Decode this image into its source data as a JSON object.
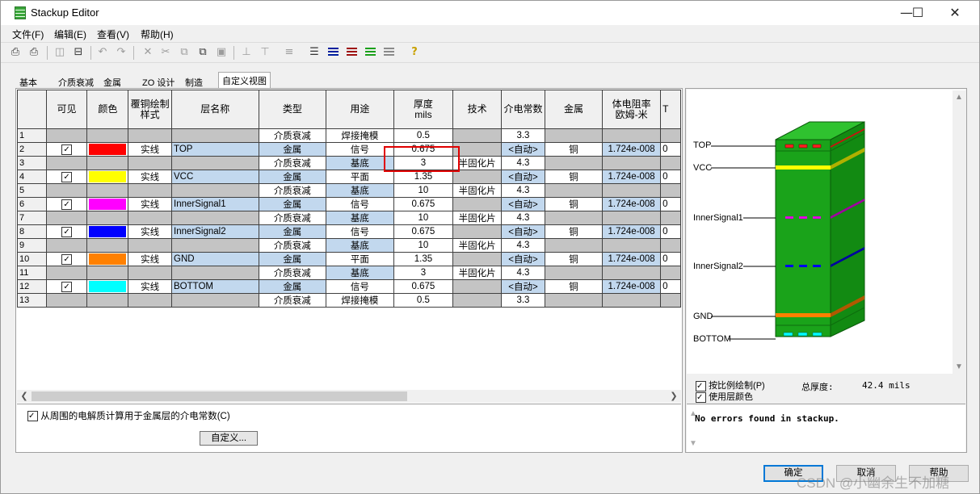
{
  "window": {
    "title": "Stackup Editor",
    "minimize": "—",
    "maximize": "☐",
    "close": "✕"
  },
  "menu": [
    "文件(F)",
    "编辑(E)",
    "查看(V)",
    "帮助(H)"
  ],
  "tabs": [
    "基本",
    "介质衰减",
    "金属",
    "ZO 设计",
    "制造",
    "自定义视图"
  ],
  "active_tab": "自定义视图",
  "grid": {
    "headers": [
      "可见",
      "颜色",
      "覆铜绘制\n样式",
      "层名称",
      "类型",
      "用途",
      "厚度\nmils",
      "技术",
      "介电常数",
      "金属",
      "体电阻率\n欧姆-米",
      "T"
    ],
    "rows": [
      {
        "num": "1",
        "visible": false,
        "color": "",
        "style": "",
        "name": "",
        "type": "介质衰减",
        "usage": "焊接掩模",
        "thickness": "0.5",
        "tech": "",
        "dk": "3.3",
        "metal": "",
        "resist": "",
        "extra": ""
      },
      {
        "num": "2",
        "visible": true,
        "color": "#ff0000",
        "style": "实线",
        "name": "TOP",
        "type": "金属",
        "usage": "信号",
        "thickness": "0.675",
        "tech": "",
        "dk": "<自动>",
        "metal": "铜",
        "resist": "1.724e-008",
        "extra": "0"
      },
      {
        "num": "3",
        "visible": false,
        "color": "",
        "style": "",
        "name": "",
        "type": "介质衰减",
        "usage": "基底",
        "thickness": "3",
        "tech": "半固化片",
        "dk": "4.3",
        "metal": "",
        "resist": "",
        "extra": ""
      },
      {
        "num": "4",
        "visible": true,
        "color": "#ffff00",
        "style": "实线",
        "name": "VCC",
        "type": "金属",
        "usage": "平面",
        "thickness": "1.35",
        "tech": "",
        "dk": "<自动>",
        "metal": "铜",
        "resist": "1.724e-008",
        "extra": "0"
      },
      {
        "num": "5",
        "visible": false,
        "color": "",
        "style": "",
        "name": "",
        "type": "介质衰减",
        "usage": "基底",
        "thickness": "10",
        "tech": "半固化片",
        "dk": "4.3",
        "metal": "",
        "resist": "",
        "extra": ""
      },
      {
        "num": "6",
        "visible": true,
        "color": "#ff00ff",
        "style": "实线",
        "name": "InnerSignal1",
        "type": "金属",
        "usage": "信号",
        "thickness": "0.675",
        "tech": "",
        "dk": "<自动>",
        "metal": "铜",
        "resist": "1.724e-008",
        "extra": "0"
      },
      {
        "num": "7",
        "visible": false,
        "color": "",
        "style": "",
        "name": "",
        "type": "介质衰减",
        "usage": "基底",
        "thickness": "10",
        "tech": "半固化片",
        "dk": "4.3",
        "metal": "",
        "resist": "",
        "extra": ""
      },
      {
        "num": "8",
        "visible": true,
        "color": "#0000ff",
        "style": "实线",
        "name": "InnerSignal2",
        "type": "金属",
        "usage": "信号",
        "thickness": "0.675",
        "tech": "",
        "dk": "<自动>",
        "metal": "铜",
        "resist": "1.724e-008",
        "extra": "0"
      },
      {
        "num": "9",
        "visible": false,
        "color": "",
        "style": "",
        "name": "",
        "type": "介质衰减",
        "usage": "基底",
        "thickness": "10",
        "tech": "半固化片",
        "dk": "4.3",
        "metal": "",
        "resist": "",
        "extra": ""
      },
      {
        "num": "10",
        "visible": true,
        "color": "#ff8000",
        "style": "实线",
        "name": "GND",
        "type": "金属",
        "usage": "平面",
        "thickness": "1.35",
        "tech": "",
        "dk": "<自动>",
        "metal": "铜",
        "resist": "1.724e-008",
        "extra": "0"
      },
      {
        "num": "11",
        "visible": false,
        "color": "",
        "style": "",
        "name": "",
        "type": "介质衰减",
        "usage": "基底",
        "thickness": "3",
        "tech": "半固化片",
        "dk": "4.3",
        "metal": "",
        "resist": "",
        "extra": ""
      },
      {
        "num": "12",
        "visible": true,
        "color": "#00ffff",
        "style": "实线",
        "name": "BOTTOM",
        "type": "金属",
        "usage": "信号",
        "thickness": "0.675",
        "tech": "",
        "dk": "<自动>",
        "metal": "铜",
        "resist": "1.724e-008",
        "extra": "0"
      },
      {
        "num": "13",
        "visible": false,
        "color": "",
        "style": "",
        "name": "",
        "type": "介质衰减",
        "usage": "焊接掩模",
        "thickness": "0.5",
        "tech": "",
        "dk": "3.3",
        "metal": "",
        "resist": "",
        "extra": ""
      }
    ]
  },
  "options": {
    "dielectric_option": "从周围的电解质计算用于金属层的介电常数(C)",
    "dielectric_checked": true,
    "custom_button": "自定义..."
  },
  "preview": {
    "layer_labels": [
      "TOP",
      "VCC",
      "InnerSignal1",
      "InnerSignal2",
      "GND",
      "BOTTOM"
    ],
    "scale_draw": "按比例绘制(P)",
    "scale_draw_checked": true,
    "use_layer_color": "使用层颜色",
    "use_layer_color_checked": true,
    "total_thickness_label": "总厚度:",
    "total_thickness_value": "42.4 mils",
    "message": "No errors found in stackup."
  },
  "buttons": {
    "ok": "确定",
    "cancel": "取消",
    "help": "帮助"
  },
  "watermark": "CSDN @小幽余生不加糖",
  "colors": {
    "board_green": "#1a9a1a",
    "highlight": "#e00000",
    "metal_cell": "#c2d8ee",
    "grey_cell": "#c4c4c4"
  }
}
